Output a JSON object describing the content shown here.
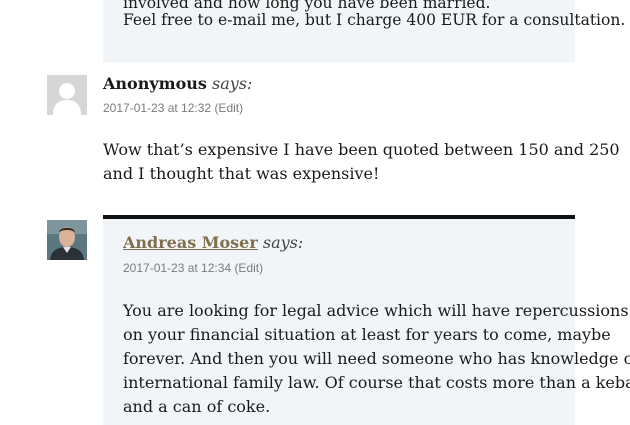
{
  "previous_reply": {
    "partial_line": "involved and how long you have been married.",
    "text": "Feel free to e-mail me, but I charge 400 EUR for a consultation."
  },
  "comments": [
    {
      "author": "Anonymous",
      "says": "says:",
      "timestamp": "2017-01-23 at 12:32",
      "edit_label": "(Edit)",
      "avatar": "default-avatar-icon",
      "body_lines": [
        "Wow that’s expensive I have been quoted between 150 and 250",
        "and I thought that was expensive!"
      ]
    },
    {
      "author": "Andreas Moser",
      "says": "says:",
      "timestamp": "2017-01-23 at 12:34",
      "edit_label": "(Edit)",
      "avatar": "author-photo",
      "body_lines": [
        "You are looking for legal advice which will have repercussions",
        "on your financial situation at least for years to come, maybe",
        "forever. And then you will need someone who has knowledge of",
        "international family law. Of course that costs more than a kebab",
        "and a can of coke."
      ]
    }
  ],
  "colors": {
    "reply_background": "#f2f5f7",
    "reply_border": "#111111",
    "author_link": "#7f6f4d",
    "meta_text": "#7b7b7b"
  }
}
